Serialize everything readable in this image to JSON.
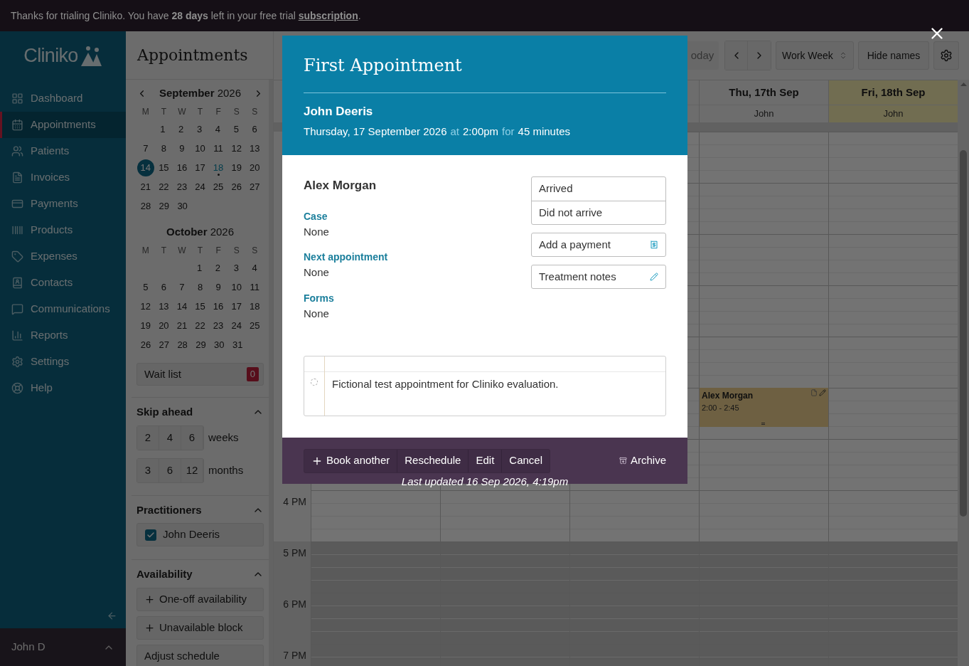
{
  "banner": {
    "text": "Thanks for trialing Cliniko. You have **28 days** left in your free trial",
    "link": "subscription",
    "end": "."
  },
  "sidebar": {
    "logo": "Cliniko",
    "items": [
      {
        "label": "Dashboard",
        "selected": false
      },
      {
        "label": "Appointments",
        "selected": true
      },
      {
        "label": "Patients",
        "selected": false
      },
      {
        "label": "Invoices",
        "selected": false
      },
      {
        "label": "Payments",
        "selected": false
      },
      {
        "label": "Products",
        "selected": false
      },
      {
        "label": "Expenses",
        "selected": false
      },
      {
        "label": "Contacts",
        "selected": false
      },
      {
        "label": "Communications",
        "selected": false
      },
      {
        "label": "Reports",
        "selected": false
      },
      {
        "label": "Settings",
        "selected": false
      },
      {
        "label": "Help",
        "selected": false
      }
    ],
    "user": "John D"
  },
  "panel": {
    "title": "Appointments",
    "months": [
      {
        "title": "**September** 2026",
        "weekdays": [
          "M",
          "T",
          "W",
          "T",
          "F",
          "S",
          "S"
        ],
        "nav": true,
        "first_week_right_aligned": true,
        "weeks": [
          {
            "days": [
              {
                "day": "1",
                "selected": false,
                "marked": false
              },
              {
                "day": "2",
                "selected": false,
                "marked": false
              },
              {
                "day": "3",
                "selected": false,
                "marked": false
              },
              {
                "day": "4",
                "selected": false,
                "marked": false
              },
              {
                "day": "5",
                "selected": false,
                "marked": false
              },
              {
                "day": "6",
                "selected": false,
                "marked": false
              }
            ]
          },
          {
            "days": [
              {
                "day": "7",
                "selected": false,
                "marked": false
              },
              {
                "day": "8",
                "selected": false,
                "marked": false
              },
              {
                "day": "9",
                "selected": false,
                "marked": false
              },
              {
                "day": "10",
                "selected": false,
                "marked": false
              },
              {
                "day": "11",
                "selected": false,
                "marked": false
              },
              {
                "day": "12",
                "selected": false,
                "marked": false
              },
              {
                "day": "13",
                "selected": false,
                "marked": false
              }
            ]
          },
          {
            "days": [
              {
                "day": "14",
                "selected": true,
                "marked": false
              },
              {
                "day": "15",
                "selected": false,
                "marked": false
              },
              {
                "day": "16",
                "selected": false,
                "marked": false
              },
              {
                "day": "17",
                "selected": false,
                "marked": false
              },
              {
                "day": "18",
                "selected": false,
                "marked": true
              },
              {
                "day": "19",
                "selected": false,
                "marked": false
              },
              {
                "day": "20",
                "selected": false,
                "marked": false
              }
            ]
          },
          {
            "days": [
              {
                "day": "21",
                "selected": false,
                "marked": false
              },
              {
                "day": "22",
                "selected": false,
                "marked": false
              },
              {
                "day": "23",
                "selected": false,
                "marked": false
              },
              {
                "day": "24",
                "selected": false,
                "marked": false
              },
              {
                "day": "25",
                "selected": false,
                "marked": false
              },
              {
                "day": "26",
                "selected": false,
                "marked": false
              },
              {
                "day": "27",
                "selected": false,
                "marked": false
              }
            ]
          },
          {
            "days": [
              {
                "day": "28",
                "selected": false,
                "marked": false
              },
              {
                "day": "29",
                "selected": false,
                "marked": false
              },
              {
                "day": "30",
                "selected": false,
                "marked": false
              }
            ]
          }
        ]
      },
      {
        "title": "**October** 2026",
        "weekdays": [
          "M",
          "T",
          "W",
          "T",
          "F",
          "S",
          "S"
        ],
        "nav": false,
        "first_week_right_aligned": true,
        "weeks": [
          {
            "days": [
              {
                "day": "1",
                "selected": false,
                "marked": false
              },
              {
                "day": "2",
                "selected": false,
                "marked": false
              },
              {
                "day": "3",
                "selected": false,
                "marked": false
              },
              {
                "day": "4",
                "selected": false,
                "marked": false
              }
            ]
          },
          {
            "days": [
              {
                "day": "5",
                "selected": false,
                "marked": false
              },
              {
                "day": "6",
                "selected": false,
                "marked": false
              },
              {
                "day": "7",
                "selected": false,
                "marked": false
              },
              {
                "day": "8",
                "selected": false,
                "marked": false
              },
              {
                "day": "9",
                "selected": false,
                "marked": false
              },
              {
                "day": "10",
                "selected": false,
                "marked": false
              },
              {
                "day": "11",
                "selected": false,
                "marked": false
              }
            ]
          },
          {
            "days": [
              {
                "day": "12",
                "selected": false,
                "marked": false
              },
              {
                "day": "13",
                "selected": false,
                "marked": false
              },
              {
                "day": "14",
                "selected": false,
                "marked": false
              },
              {
                "day": "15",
                "selected": false,
                "marked": false
              },
              {
                "day": "16",
                "selected": false,
                "marked": false
              },
              {
                "day": "17",
                "selected": false,
                "marked": false
              },
              {
                "day": "18",
                "selected": false,
                "marked": false
              }
            ]
          },
          {
            "days": [
              {
                "day": "19",
                "selected": false,
                "marked": false
              },
              {
                "day": "20",
                "selected": false,
                "marked": false
              },
              {
                "day": "21",
                "selected": false,
                "marked": false
              },
              {
                "day": "22",
                "selected": false,
                "marked": false
              },
              {
                "day": "23",
                "selected": false,
                "marked": false
              },
              {
                "day": "24",
                "selected": false,
                "marked": false
              },
              {
                "day": "25",
                "selected": false,
                "marked": false
              }
            ]
          },
          {
            "days": [
              {
                "day": "26",
                "selected": false,
                "marked": false
              },
              {
                "day": "27",
                "selected": false,
                "marked": false
              },
              {
                "day": "28",
                "selected": false,
                "marked": false
              },
              {
                "day": "29",
                "selected": false,
                "marked": false
              },
              {
                "day": "30",
                "selected": false,
                "marked": false
              },
              {
                "day": "31",
                "selected": false,
                "marked": false
              }
            ]
          }
        ]
      }
    ],
    "wait_list": {
      "label": "Wait list",
      "count": "0"
    },
    "skip_ahead": {
      "title": "Skip ahead",
      "rows": [
        {
          "options": [
            "2",
            "4",
            "6"
          ],
          "unit": "weeks"
        },
        {
          "options": [
            "3",
            "6",
            "12"
          ],
          "unit": "months"
        }
      ]
    },
    "practitioners": {
      "title": "Practitioners",
      "items": [
        {
          "name": "John Deeris",
          "checked": true
        }
      ]
    },
    "availability": {
      "title": "Availability",
      "buttons": [
        {
          "label": "One-off availability",
          "kind": "add"
        },
        {
          "label": "Unavailable block",
          "kind": "add"
        },
        {
          "label": "Adjust schedule",
          "kind": "plain"
        }
      ]
    }
  },
  "toolbar": {
    "today": "oday",
    "view": "Work Week",
    "hide_names": "Hide names"
  },
  "calendar": {
    "columns": [
      {
        "date": "Thu, 17th Sep",
        "practitioner": "John",
        "highlight": false,
        "appointments": [
          {
            "patient": "Alex Morgan",
            "time": "2:00 - 2:45"
          }
        ]
      },
      {
        "date": "Fri, 18th Sep",
        "practitioner": "John",
        "highlight": true
      }
    ],
    "hours": [
      {
        "available": true
      },
      {
        "available": true
      },
      {
        "available": true
      },
      {
        "available": true
      },
      {
        "available": true
      },
      {
        "available": true
      },
      {
        "available": true
      },
      {
        "label": "4 PM",
        "available": true
      },
      {
        "label": "5 PM",
        "available": false
      },
      {
        "label": "6 PM",
        "available": false
      },
      {
        "label": "7 PM",
        "available": false
      }
    ]
  },
  "modal": {
    "title": "First Appointment",
    "practitioner": "John Deeris",
    "date": "Thursday, 17 September 2026",
    "at": "at",
    "time": "2:00pm",
    "for": "for",
    "duration": "45 minutes",
    "patient": "Alex Morgan",
    "fields": [
      {
        "label": "Case",
        "value": "None"
      },
      {
        "label": "Next appointment",
        "value": "None"
      },
      {
        "label": "Forms",
        "value": "None"
      }
    ],
    "attendance": [
      "Arrived",
      "Did not arrive"
    ],
    "actions": [
      {
        "label": "Add a payment",
        "kind": "payment"
      },
      {
        "label": "Treatment notes",
        "kind": "notes"
      }
    ],
    "note": "Fictional test appointment for Cliniko evaluation.",
    "footer_buttons": [
      {
        "label": "Book another",
        "kind": "add"
      },
      {
        "label": "Reschedule",
        "kind": "plain"
      },
      {
        "label": "Edit",
        "kind": "plain"
      },
      {
        "label": "Cancel",
        "kind": "plain"
      }
    ],
    "archive": "Archive",
    "last_updated": "Last updated 16 Sep 2026, 4:19pm"
  }
}
